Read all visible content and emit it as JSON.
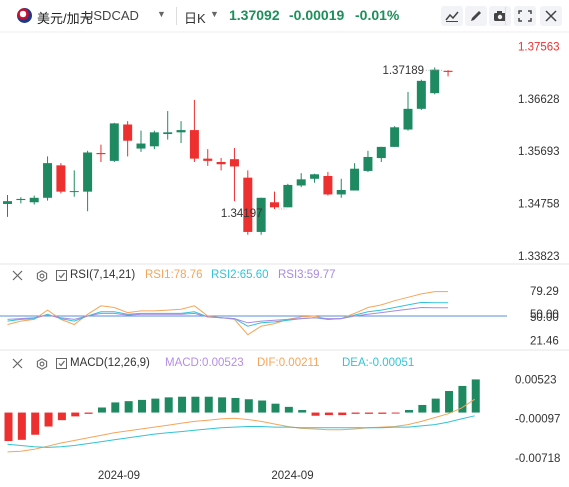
{
  "header": {
    "pair_name": "美元/加元",
    "symbol": "USDCAD",
    "interval": "日K",
    "price": "1.37092",
    "change": "-0.00019",
    "change_pct": "-0.01%",
    "toolbar_icons": [
      "chart-settings-icon",
      "draw-icon",
      "camera-icon",
      "fullscreen-icon",
      "close-icon"
    ]
  },
  "colors": {
    "up": "#1f8a62",
    "down": "#ee2f2f",
    "rsi1": "#f5a55a",
    "rsi2": "#33c3d6",
    "rsi3": "#a78be0",
    "macd": "#b58de6",
    "dif": "#f5a55a",
    "dea": "#33c3d6"
  },
  "chart_data": [
    {
      "type": "candlestick",
      "title": "",
      "ylim": [
        1.3382,
        1.3768
      ],
      "y_ticks": [
        "1.37563",
        "1.36628",
        "1.35693",
        "1.34758",
        "1.33823"
      ],
      "highlight_tick": "1.37563",
      "annotations": [
        {
          "text": "1.37189",
          "at_candle": 33,
          "type": "high"
        },
        {
          "text": "1.34197",
          "at_candle": 20,
          "type": "low"
        }
      ],
      "candles": [
        {
          "o": 1.3475,
          "c": 1.348,
          "h": 1.3491,
          "l": 1.3452
        },
        {
          "o": 1.3482,
          "c": 1.3484,
          "h": 1.3487,
          "l": 1.3476
        },
        {
          "o": 1.3478,
          "c": 1.3486,
          "h": 1.349,
          "l": 1.3474
        },
        {
          "o": 1.3486,
          "c": 1.3548,
          "h": 1.356,
          "l": 1.3481
        },
        {
          "o": 1.3544,
          "c": 1.3497,
          "h": 1.3548,
          "l": 1.3494
        },
        {
          "o": 1.3497,
          "c": 1.3498,
          "h": 1.3535,
          "l": 1.3488
        },
        {
          "o": 1.3497,
          "c": 1.3567,
          "h": 1.357,
          "l": 1.3462
        },
        {
          "o": 1.3566,
          "c": 1.3564,
          "h": 1.3581,
          "l": 1.355
        },
        {
          "o": 1.3552,
          "c": 1.3619,
          "h": 1.362,
          "l": 1.355
        },
        {
          "o": 1.3617,
          "c": 1.3588,
          "h": 1.3623,
          "l": 1.356
        },
        {
          "o": 1.3574,
          "c": 1.3583,
          "h": 1.3606,
          "l": 1.3568
        },
        {
          "o": 1.3578,
          "c": 1.3603,
          "h": 1.3606,
          "l": 1.3573
        },
        {
          "o": 1.36,
          "c": 1.3603,
          "h": 1.3641,
          "l": 1.359
        },
        {
          "o": 1.3603,
          "c": 1.3607,
          "h": 1.3623,
          "l": 1.3584
        },
        {
          "o": 1.3607,
          "c": 1.3556,
          "h": 1.3661,
          "l": 1.355
        },
        {
          "o": 1.3556,
          "c": 1.3552,
          "h": 1.3573,
          "l": 1.3543
        },
        {
          "o": 1.355,
          "c": 1.3546,
          "h": 1.3557,
          "l": 1.3535
        },
        {
          "o": 1.3555,
          "c": 1.3542,
          "h": 1.3575,
          "l": 1.348
        },
        {
          "o": 1.3522,
          "c": 1.3425,
          "h": 1.3535,
          "l": 1.342
        },
        {
          "o": 1.3425,
          "c": 1.3486,
          "h": 1.3486,
          "l": 1.342
        },
        {
          "o": 1.3478,
          "c": 1.3469,
          "h": 1.3497,
          "l": 1.3466
        },
        {
          "o": 1.3469,
          "c": 1.3509,
          "h": 1.3511,
          "l": 1.3469
        },
        {
          "o": 1.3508,
          "c": 1.3519,
          "h": 1.353,
          "l": 1.3505
        },
        {
          "o": 1.352,
          "c": 1.3528,
          "h": 1.3529,
          "l": 1.3513
        },
        {
          "o": 1.3525,
          "c": 1.3492,
          "h": 1.3532,
          "l": 1.349
        },
        {
          "o": 1.3492,
          "c": 1.35,
          "h": 1.352,
          "l": 1.3486
        },
        {
          "o": 1.3499,
          "c": 1.3538,
          "h": 1.3548,
          "l": 1.3499
        },
        {
          "o": 1.3534,
          "c": 1.3559,
          "h": 1.357,
          "l": 1.3532
        },
        {
          "o": 1.3557,
          "c": 1.3577,
          "h": 1.3577,
          "l": 1.355
        },
        {
          "o": 1.3577,
          "c": 1.3612,
          "h": 1.3614,
          "l": 1.3577
        },
        {
          "o": 1.3608,
          "c": 1.3645,
          "h": 1.3675,
          "l": 1.3606
        },
        {
          "o": 1.3645,
          "c": 1.3695,
          "h": 1.3697,
          "l": 1.3643
        },
        {
          "o": 1.3673,
          "c": 1.3715,
          "h": 1.3719,
          "l": 1.3671
        },
        {
          "o": 1.3713,
          "c": 1.3711,
          "h": 1.3714,
          "l": 1.3703
        }
      ]
    },
    {
      "type": "line",
      "title": "RSI(7,14,21)",
      "ylim": [
        0,
        100
      ],
      "y_ticks": [
        "79.29",
        "50.00",
        "50.00",
        "21.46"
      ],
      "reference_line": 50,
      "series": [
        {
          "name": "RSI1",
          "label": "RSI1:78.76",
          "values": [
            40,
            44,
            46,
            57,
            46,
            40,
            52,
            62,
            60,
            54,
            56,
            56,
            57,
            58,
            62,
            50,
            48,
            46,
            28,
            38,
            41,
            46,
            49,
            50,
            46,
            47,
            53,
            60,
            63,
            68,
            72,
            76,
            78.76,
            78.76
          ]
        },
        {
          "name": "RSI2",
          "label": "RSI2:65.60",
          "values": [
            44,
            46,
            47,
            52,
            47,
            44,
            50,
            55,
            55,
            52,
            53,
            53,
            53,
            53,
            55,
            49,
            48,
            47,
            38,
            42,
            43,
            45,
            47,
            48,
            46,
            47,
            51,
            55,
            57,
            60,
            63,
            66,
            65.6,
            65.6
          ]
        },
        {
          "name": "RSI3",
          "label": "RSI3:59.77",
          "values": [
            46,
            47,
            48,
            51,
            48,
            46,
            50,
            53,
            53,
            51,
            52,
            52,
            52,
            52,
            53,
            49,
            48,
            47,
            42,
            44,
            45,
            46,
            47,
            48,
            47,
            47,
            50,
            52,
            54,
            56,
            58,
            60,
            59.77,
            59.77
          ]
        }
      ]
    },
    {
      "type": "bar+line",
      "title": "MACD(12,26,9)",
      "y_ticks": [
        "0.00523",
        "-0.00097",
        "-0.00718"
      ],
      "ylim": [
        -0.0078,
        0.0064
      ],
      "series": [
        {
          "name": "MACD",
          "label": "MACD:0.00523",
          "values": [
            -0.0045,
            -0.0043,
            -0.0035,
            -0.0022,
            -0.0012,
            -0.0006,
            -0.0002,
            0.0008,
            0.0016,
            0.0018,
            0.002,
            0.0022,
            0.0024,
            0.0025,
            0.0025,
            0.0025,
            0.0024,
            0.0023,
            0.0021,
            0.0019,
            0.0014,
            0.0009,
            0.0004,
            -0.0005,
            -0.0004,
            -0.0004,
            -0.0002,
            -0.0002,
            -0.0002,
            -0.0001,
            0.0004,
            0.0012,
            0.0022,
            0.0034,
            0.0042,
            0.00523
          ]
        },
        {
          "name": "DIF",
          "label": "DIF:0.00211",
          "values": [
            -0.0062,
            -0.0061,
            -0.0058,
            -0.0053,
            -0.0048,
            -0.0044,
            -0.004,
            -0.0036,
            -0.0032,
            -0.0029,
            -0.0026,
            -0.0023,
            -0.002,
            -0.0017,
            -0.0014,
            -0.0012,
            -0.001,
            -0.0009,
            -0.0011,
            -0.0014,
            -0.0018,
            -0.0022,
            -0.0025,
            -0.0026,
            -0.0027,
            -0.0027,
            -0.0026,
            -0.0024,
            -0.0023,
            -0.0022,
            -0.0019,
            -0.0014,
            -0.0008,
            -0.0002,
            0.0007,
            0.00211
          ]
        },
        {
          "name": "DEA",
          "label": "DEA:-0.00051",
          "values": [
            -0.005,
            -0.0052,
            -0.0054,
            -0.0055,
            -0.0054,
            -0.0052,
            -0.0049,
            -0.0046,
            -0.0043,
            -0.004,
            -0.0037,
            -0.0034,
            -0.0032,
            -0.003,
            -0.0028,
            -0.0026,
            -0.0024,
            -0.0023,
            -0.0022,
            -0.0022,
            -0.0023,
            -0.0023,
            -0.0024,
            -0.0024,
            -0.0024,
            -0.0024,
            -0.0024,
            -0.0024,
            -0.0024,
            -0.0023,
            -0.0023,
            -0.0021,
            -0.0019,
            -0.0015,
            -0.001,
            -0.00051
          ]
        }
      ]
    }
  ],
  "x_ticks": [
    {
      "label": "2024-09",
      "at_candle": 7
    },
    {
      "label": "2024-09",
      "at_candle": 20
    }
  ]
}
